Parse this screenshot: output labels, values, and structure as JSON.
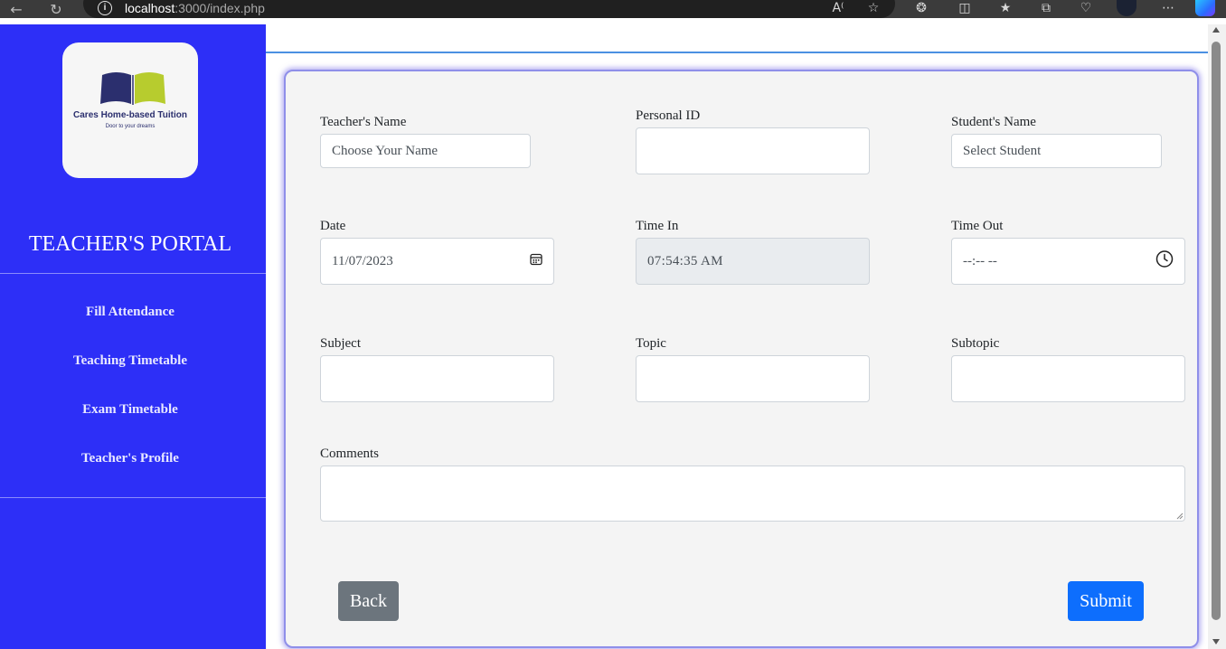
{
  "browser": {
    "back_icon": "arrow-left-icon",
    "reload_icon": "reload-icon",
    "url_host": "localhost",
    "url_rest": ":3000/index.php",
    "toolbar_icons": [
      "read-aloud-icon",
      "favorite-star-icon",
      "extensions-icon",
      "split-screen-icon",
      "favorites-icon",
      "collections-icon",
      "browser-health-icon",
      "profile-avatar-icon",
      "more-icon",
      "copilot-icon"
    ]
  },
  "sidebar": {
    "logo": {
      "title": "Cares Home-based Tuition",
      "tagline": "Door to your dreams"
    },
    "portal_title": "TEACHER'S PORTAL",
    "items": [
      {
        "label": "Fill Attendance"
      },
      {
        "label": "Teaching Timetable"
      },
      {
        "label": "Exam Timetable"
      },
      {
        "label": "Teacher's Profile"
      }
    ],
    "color": "#2d2ff7"
  },
  "form": {
    "teacher_name": {
      "label": "Teacher's Name",
      "value": "Choose Your Name"
    },
    "personal_id": {
      "label": "Personal ID",
      "value": ""
    },
    "student_name": {
      "label": "Student's Name",
      "value": "Select Student"
    },
    "date": {
      "label": "Date",
      "value": "11/07/2023"
    },
    "time_in": {
      "label": "Time In",
      "value": "07:54:35 AM"
    },
    "time_out": {
      "label": "Time Out",
      "value": "--:-- --"
    },
    "subject": {
      "label": "Subject",
      "value": ""
    },
    "topic": {
      "label": "Topic",
      "value": ""
    },
    "subtopic": {
      "label": "Subtopic",
      "value": ""
    },
    "comments": {
      "label": "Comments",
      "value": ""
    },
    "back_label": "Back",
    "submit_label": "Submit"
  },
  "colors": {
    "back_button": "#6c757d",
    "submit_button": "#0d6efd",
    "card_border": "#8f8fe9"
  }
}
